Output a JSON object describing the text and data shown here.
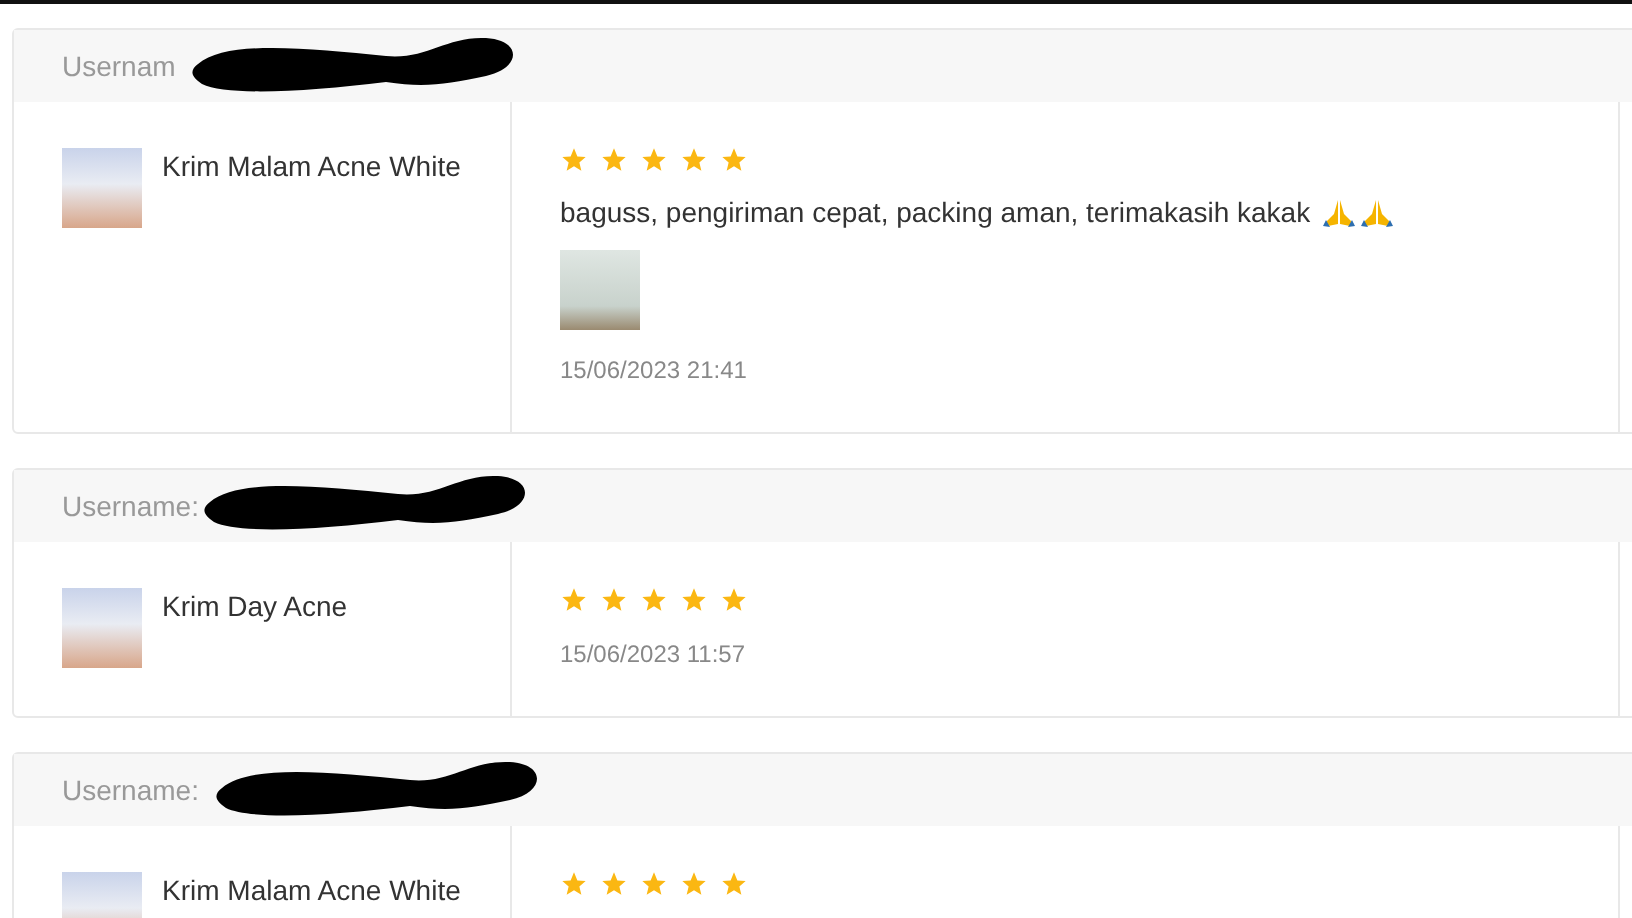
{
  "reviews": [
    {
      "username_label": "Usernam",
      "product": "Krim Malam Acne White",
      "stars": 5,
      "comment": "baguss, pengiriman cepat, packing aman, terimakasih kakak",
      "emojis": [
        {
          "kind": "praying-hands"
        },
        {
          "kind": "praying-hands"
        }
      ],
      "has_photo": true,
      "date": "15/06/2023 21:41"
    },
    {
      "username_label": "Username:",
      "product": "Krim Day Acne",
      "stars": 5,
      "date": "15/06/2023 11:57"
    },
    {
      "username_label": "Username:",
      "product": "Krim Malam Acne White",
      "stars": 5
    }
  ]
}
